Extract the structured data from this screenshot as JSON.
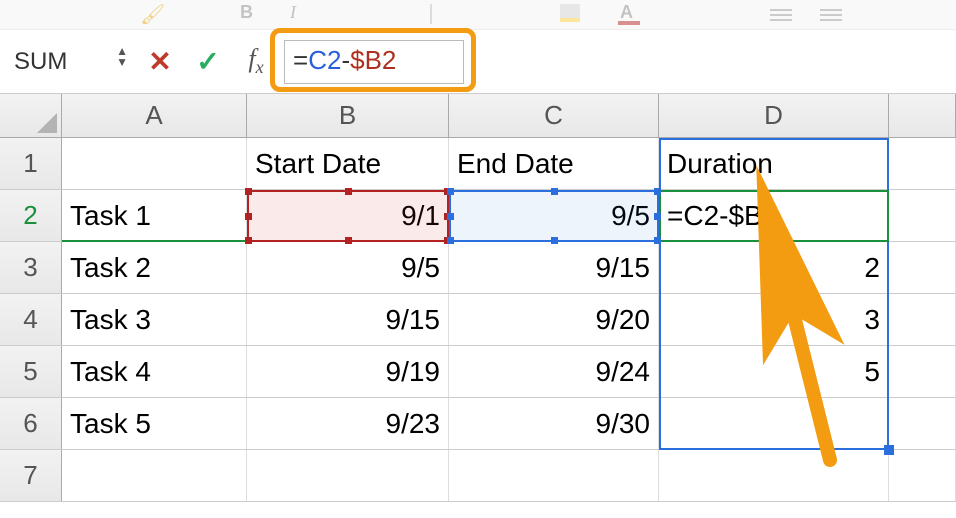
{
  "name_box": "SUM",
  "formula_bar": {
    "prefix_eq": "=",
    "ref1": "C2",
    "op": "-",
    "ref2": "$B2"
  },
  "columns": [
    "A",
    "B",
    "C",
    "D"
  ],
  "row_numbers": [
    "1",
    "2",
    "3",
    "4",
    "5",
    "6",
    "7"
  ],
  "header_row": {
    "B": "Start Date",
    "C": "End Date",
    "D": "Duration"
  },
  "rows": [
    {
      "A": "Task 1",
      "B": "9/1",
      "C": "9/5",
      "D": "=C2-$B2"
    },
    {
      "A": "Task 2",
      "B": "9/5",
      "C": "9/15",
      "D": "2"
    },
    {
      "A": "Task 3",
      "B": "9/15",
      "C": "9/20",
      "D": "3"
    },
    {
      "A": "Task 4",
      "B": "9/19",
      "C": "9/24",
      "D": "5"
    },
    {
      "A": "Task 5",
      "B": "9/23",
      "C": "9/30",
      "D": ""
    }
  ],
  "active_cell": "D2",
  "selected_range": "D1:D6",
  "formula_refs": {
    "blue": "C2",
    "red": "B2"
  },
  "annotations": {
    "highlight_formula_bar": true,
    "arrow_pointing_to": "D2"
  }
}
